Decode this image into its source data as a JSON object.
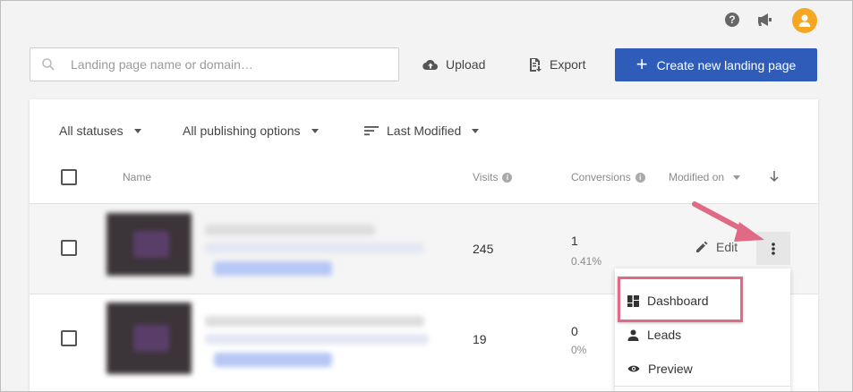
{
  "header": {
    "icons": [
      "help-icon",
      "megaphone-icon",
      "avatar-user-icon"
    ],
    "help_glyph": "?"
  },
  "toolbar": {
    "search_placeholder": "Landing page name or domain…",
    "upload_label": "Upload",
    "export_label": "Export",
    "create_label": "Create new landing page",
    "create_glyph": "+",
    "accent_color": "#2f5cb8"
  },
  "filters": {
    "status": "All statuses",
    "publishing": "All publishing options",
    "sort": "Last Modified"
  },
  "table": {
    "columns": {
      "name": "Name",
      "visits": "Visits",
      "conversions": "Conversions",
      "modified": "Modified on"
    },
    "info_glyph": "i",
    "rows": [
      {
        "visits": "245",
        "conversions": "1",
        "conversion_rate": "0.41%",
        "edit_label": "Edit"
      },
      {
        "visits": "19",
        "conversions": "0",
        "conversion_rate": "0%"
      }
    ]
  },
  "row_menu": {
    "items": [
      {
        "label": "Dashboard",
        "icon": "dashboard-icon"
      },
      {
        "label": "Leads",
        "icon": "person-icon"
      },
      {
        "label": "Preview",
        "icon": "eye-icon"
      }
    ],
    "highlight_color": "#e06a86"
  }
}
